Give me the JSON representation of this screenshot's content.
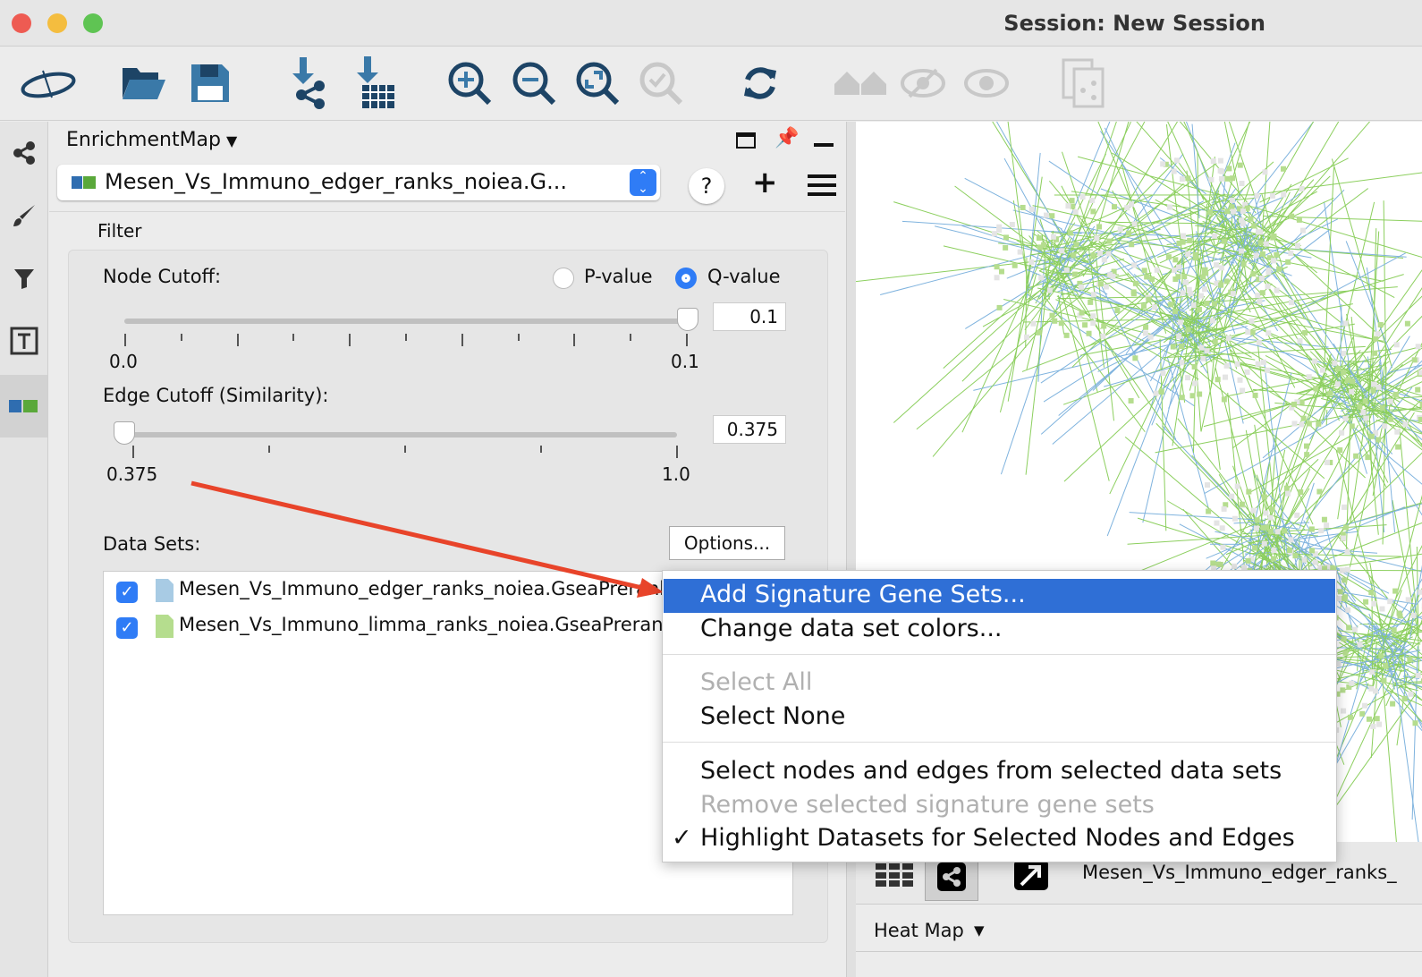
{
  "window": {
    "title": "Session: New Session"
  },
  "toolbar": {
    "icons": [
      "cytoscape-logo-icon",
      "open-folder-icon",
      "save-icon",
      "import-network-icon",
      "import-table-icon",
      "zoom-in-icon",
      "zoom-out-icon",
      "zoom-fit-icon",
      "zoom-selected-icon",
      "refresh-icon",
      "home-icon",
      "hide-icon",
      "show-icon",
      "export-icon"
    ]
  },
  "panel": {
    "title": "EnrichmentMap",
    "network_select": "Mesen_Vs_Immuno_edger_ranks_noiea.G...",
    "help": "?",
    "filter_label": "Filter",
    "node_cutoff_label": "Node Cutoff:",
    "pvalue_label": "P-value",
    "qvalue_label": "Q-value",
    "cutoff_type": "Q-value",
    "node_value": "0.1",
    "node_min": "0.0",
    "node_max": "0.1",
    "node_slider_fraction": 1.0,
    "edge_cutoff_label": "Edge Cutoff (Similarity):",
    "edge_value": "0.375",
    "edge_min": "0.375",
    "edge_max": "1.0",
    "edge_slider_fraction": 0.0,
    "datasets_label": "Data Sets:",
    "options_button": "Options...",
    "datasets": [
      {
        "name": "Mesen_Vs_Immuno_edger_ranks_noiea.GseaPreranked",
        "checked": true,
        "color": "#a8cbe4"
      },
      {
        "name": "Mesen_Vs_Immuno_limma_ranks_noiea.GseaPreranked",
        "checked": true,
        "color": "#b5dd8e"
      }
    ]
  },
  "menu": {
    "items": [
      {
        "label": "Add Signature Gene Sets...",
        "enabled": true,
        "highlighted": true
      },
      {
        "label": "Change data set colors...",
        "enabled": true
      },
      {
        "label": "Select All",
        "enabled": false
      },
      {
        "label": "Select None",
        "enabled": true
      },
      {
        "label": "Select nodes and edges from selected data sets",
        "enabled": true
      },
      {
        "label": "Remove selected signature gene sets",
        "enabled": false
      },
      {
        "label": "Highlight Datasets for Selected Nodes and Edges",
        "enabled": true,
        "checked": true
      }
    ],
    "check": "✓"
  },
  "bottom": {
    "network_name": "Mesen_Vs_Immuno_edger_ranks_",
    "heatmap_label": "Heat Map"
  },
  "colors": {
    "accent": "#2f6fd6",
    "icon_dark": "#1d4466",
    "icon_mid": "#3a79a8",
    "arrow": "#e8442a",
    "edge_green": "#8ccf5e",
    "edge_blue": "#7fb3de"
  }
}
